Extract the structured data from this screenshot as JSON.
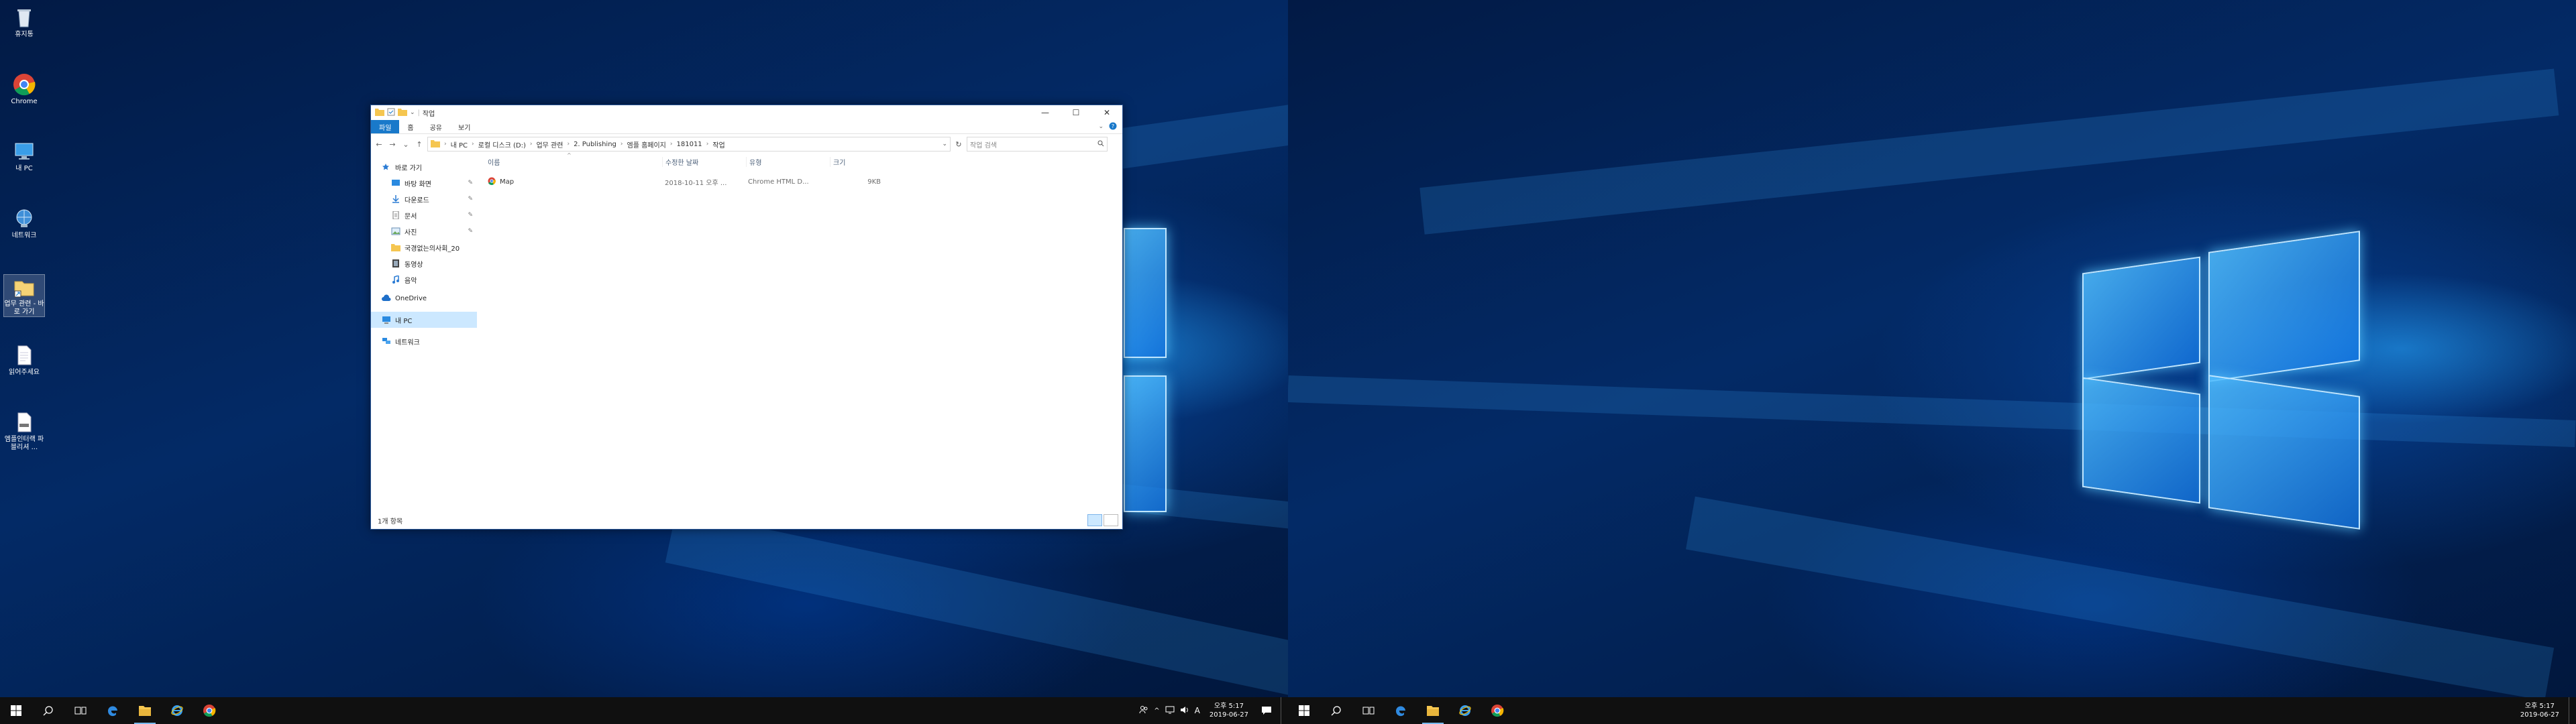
{
  "desktop": {
    "icons": [
      {
        "label": "휴지통",
        "icon": "recycle-bin-icon"
      },
      {
        "label": "Chrome",
        "icon": "chrome-icon"
      },
      {
        "label": "내 PC",
        "icon": "this-pc-icon"
      },
      {
        "label": "네트워크",
        "icon": "network-icon"
      },
      {
        "label": "업무 관련 - 바로 가기",
        "icon": "folder-shortcut-icon"
      },
      {
        "label": "읽어주세요",
        "icon": "text-file-icon"
      },
      {
        "label": "엠플인터랙 파블리셔 ...",
        "icon": "document-icon"
      }
    ]
  },
  "explorer": {
    "title": "작업",
    "window_controls": {
      "minimize": "—",
      "maximize": "☐",
      "close": "✕"
    },
    "ribbon_tabs": [
      "파일",
      "홈",
      "공유",
      "보기"
    ],
    "nav_buttons": {
      "back": "←",
      "forward": "→",
      "recent": "⌄",
      "up": "↑"
    },
    "breadcrumb": [
      "내 PC",
      "로컬 디스크 (D:)",
      "업무 관련",
      "2. Publishing",
      "엠플 홈페이지",
      "181011",
      "작업"
    ],
    "search_placeholder": "작업 검색",
    "nav_pane": {
      "quick_access": "바로 가기",
      "pinned": [
        {
          "label": "바탕 화면",
          "icon": "desktop-icon",
          "pinned": true
        },
        {
          "label": "다운로드",
          "icon": "download-icon",
          "pinned": true
        },
        {
          "label": "문서",
          "icon": "documents-icon",
          "pinned": true
        },
        {
          "label": "사진",
          "icon": "pictures-icon",
          "pinned": true
        },
        {
          "label": "국경없는의사회_20",
          "icon": "folder-icon",
          "pinned": false
        },
        {
          "label": "동영상",
          "icon": "videos-icon",
          "pinned": false
        },
        {
          "label": "음악",
          "icon": "music-icon",
          "pinned": false
        }
      ],
      "onedrive": "OneDrive",
      "this_pc": "내 PC",
      "network": "네트워크"
    },
    "columns": {
      "name": "이름",
      "date": "수정한 날짜",
      "type": "유형",
      "size": "크기"
    },
    "files": [
      {
        "name": "Map",
        "date": "2018-10-11 오후 ...",
        "type": "Chrome HTML D...",
        "size": "9KB"
      }
    ],
    "status": "1개 항목"
  },
  "taskbar": {
    "clock_time": "오후 5:17",
    "clock_date": "2019-06-27",
    "tray_glyph": "A",
    "tray_icons": [
      "people-icon",
      "chevron-up-icon",
      "network-tray-icon",
      "volume-icon",
      "ime-icon"
    ]
  },
  "colors": {
    "accent": "#1979ca",
    "taskbar": "#101010",
    "selection": "#cce8ff"
  }
}
